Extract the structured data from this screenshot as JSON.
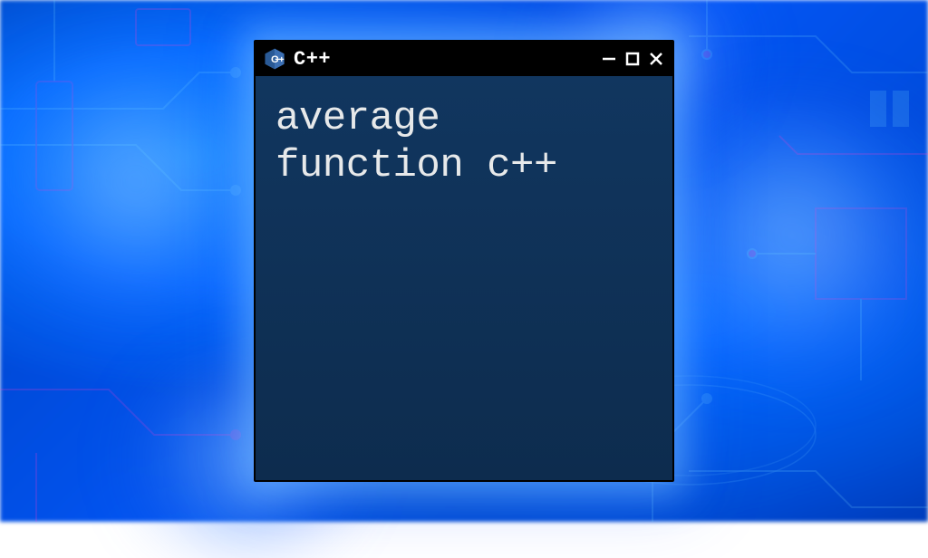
{
  "window": {
    "title": "C++",
    "icon_name": "cpp-logo-icon",
    "content_text": "average\nfunction c++"
  },
  "controls": {
    "minimize": "minimize",
    "maximize": "maximize",
    "close": "close"
  },
  "colors": {
    "titlebar_bg": "#000000",
    "content_bg": "#0f2e52",
    "text": "#e7e9ea",
    "logo_fill": "#3b6fb3",
    "logo_letter": "#ffffff"
  }
}
